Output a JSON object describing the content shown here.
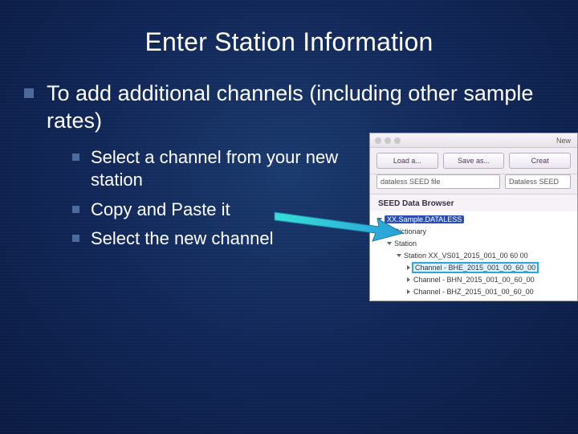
{
  "title": "Enter Station Information",
  "main_bullet": "To add additional channels (including other sample rates)",
  "sub_bullets": [
    "Select a channel from your new station",
    "Copy and Paste it",
    "Select the new channel"
  ],
  "screenshot": {
    "toolbar": {
      "load": "Load a...",
      "save": "Save as...",
      "new": "New",
      "create": "Creat"
    },
    "file_field": "dataless SEED file",
    "type_field": "Dataless SEED",
    "browser_title": "SEED Data Browser",
    "tree": {
      "root": "XX.Sample.DATALESS",
      "dictionary": "Dictionary",
      "station": "Station",
      "station_node": "Station  XX_VS01_2015_001_00 60 00",
      "channels": [
        "Channel - BHE_2015_001_00_60_00",
        "Channel - BHN_2015_001_00_60_00",
        "Channel - BHZ_2015_001_00_60_00"
      ]
    }
  }
}
